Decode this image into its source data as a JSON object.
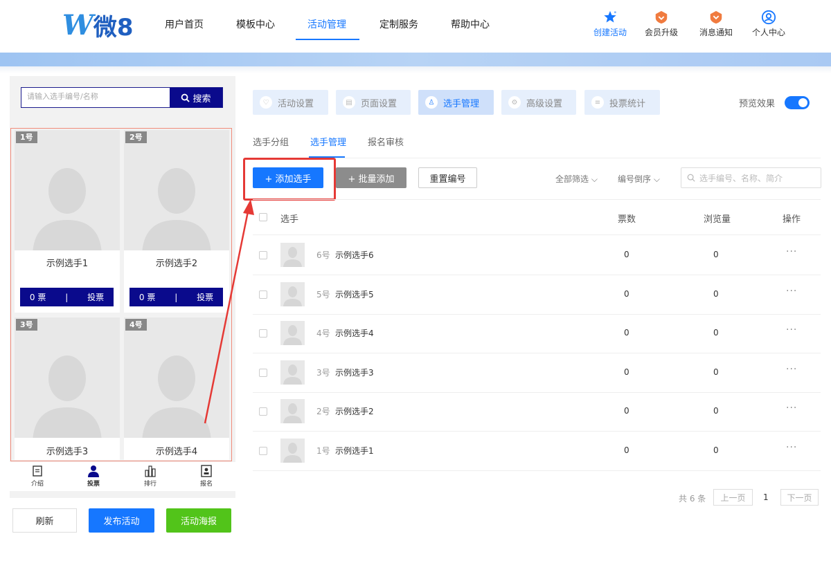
{
  "brand": {
    "logo_letter": "W",
    "logo_text": "微8"
  },
  "nav": [
    {
      "label": "用户首页",
      "active": false
    },
    {
      "label": "模板中心",
      "active": false
    },
    {
      "label": "活动管理",
      "active": true
    },
    {
      "label": "定制服务",
      "active": false
    },
    {
      "label": "帮助中心",
      "active": false
    }
  ],
  "top_actions": [
    {
      "label": "创建活动",
      "icon": "star-icon"
    },
    {
      "label": "会员升级",
      "icon": "vip-badge-icon"
    },
    {
      "label": "消息通知",
      "icon": "bell-badge-icon"
    },
    {
      "label": "个人中心",
      "icon": "user-circle-icon"
    }
  ],
  "preview": {
    "search_placeholder": "请输入选手编号/名称",
    "search_button": "搜索",
    "cards": [
      {
        "num": "1号",
        "name": "示例选手1",
        "votes": "0 票",
        "vote_btn": "投票"
      },
      {
        "num": "2号",
        "name": "示例选手2",
        "votes": "0 票",
        "vote_btn": "投票"
      },
      {
        "num": "3号",
        "name": "示例选手3"
      },
      {
        "num": "4号",
        "name": "示例选手4"
      }
    ],
    "vote_separator": "|",
    "tabbar": [
      {
        "label": "介绍",
        "icon": "document-icon"
      },
      {
        "label": "投票",
        "icon": "person-icon"
      },
      {
        "label": "排行",
        "icon": "bar-chart-icon"
      },
      {
        "label": "报名",
        "icon": "id-card-icon"
      }
    ],
    "buttons": {
      "refresh": "刷新",
      "publish": "发布活动",
      "poster": "活动海报"
    }
  },
  "steps": [
    {
      "label": "活动设置",
      "active": false
    },
    {
      "label": "页面设置",
      "active": false
    },
    {
      "label": "选手管理",
      "active": true
    },
    {
      "label": "高级设置",
      "active": false
    },
    {
      "label": "投票统计",
      "active": false
    }
  ],
  "preview_toggle_label": "预览效果",
  "preview_toggle_on": true,
  "subtabs": [
    {
      "label": "选手分组",
      "active": false
    },
    {
      "label": "选手管理",
      "active": true
    },
    {
      "label": "报名审核",
      "active": false
    }
  ],
  "toolbar": {
    "add": "+ 添加选手",
    "batch": "+ 批量添加",
    "reset": "重置编号",
    "filter_all": "全部筛选",
    "sort": "编号倒序",
    "search_placeholder": "选手编号、名称、简介"
  },
  "table": {
    "headers": {
      "player": "选手",
      "votes": "票数",
      "views": "浏览量",
      "ops": "操作"
    },
    "rows": [
      {
        "num": "6号",
        "name": "示例选手6",
        "votes": "0",
        "views": "0",
        "more": "···"
      },
      {
        "num": "5号",
        "name": "示例选手5",
        "votes": "0",
        "views": "0",
        "more": "···"
      },
      {
        "num": "4号",
        "name": "示例选手4",
        "votes": "0",
        "views": "0",
        "more": "···"
      },
      {
        "num": "3号",
        "name": "示例选手3",
        "votes": "0",
        "views": "0",
        "more": "···"
      },
      {
        "num": "2号",
        "name": "示例选手2",
        "votes": "0",
        "views": "0",
        "more": "···"
      },
      {
        "num": "1号",
        "name": "示例选手1",
        "votes": "0",
        "views": "0",
        "more": "···"
      }
    ]
  },
  "pagination": {
    "total": "共 6 条",
    "prev": "上一页",
    "current": "1",
    "next": "下一页"
  },
  "colors": {
    "primary": "#1677ff",
    "vote_navy": "#0a0a8c",
    "highlight_red": "#e53935",
    "success": "#52c41a"
  }
}
